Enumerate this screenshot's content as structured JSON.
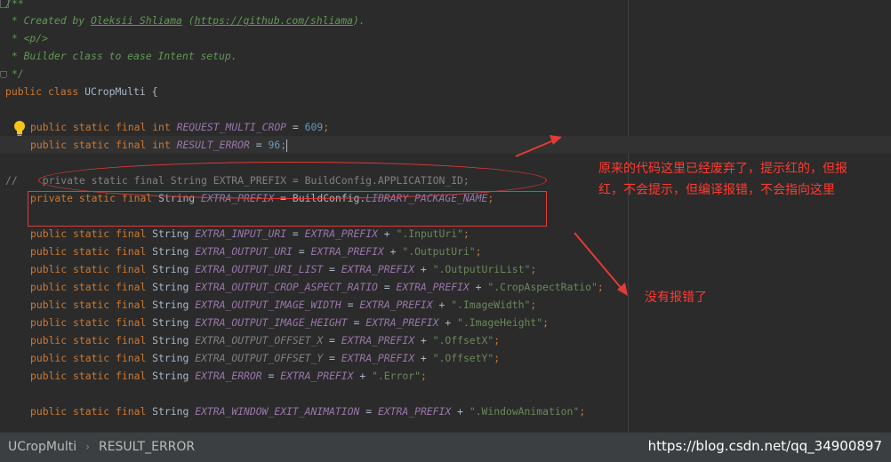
{
  "editor": {
    "lines": {
      "l1": "/**",
      "l2_pre": " * Created by ",
      "l2_author": "Oleksii Shliama",
      "l2_mid": " (",
      "l2_url": "https://github.com/shliama",
      "l2_post": ").",
      "l3": " * <p/>",
      "l4": " * Builder class to ease Intent setup.",
      "l5": " */",
      "l6_kw": "public class",
      "l6_name": " UCropMulti {",
      "l8_kw": "public static final int",
      "l8_const": "REQUEST_MULTI_CROP",
      "l8_eq": " = ",
      "l8_num": "609",
      "l8_end": ";",
      "l9_kw": "public static final int",
      "l9_const": "RESULT_ERROR",
      "l9_eq": " = ",
      "l9_num": "96",
      "l9_end": ";",
      "l11_prefix": "//",
      "l11_code": "private static final String EXTRA_PREFIX = BuildConfig.APPLICATION_ID;",
      "l12_kw": "private static final",
      "l12_type": " String ",
      "l12_const": "EXTRA_PREFIX",
      "l12_mid": " = BuildConfig.",
      "l12_const2": "LIBRARY_PACKAGE_NAME",
      "l12_end": ";"
    },
    "extras": [
      {
        "kw": "public static final",
        "type": " String ",
        "name": "EXTRA_INPUT_URI",
        "plus": " = ",
        "prefix": "EXTRA_PREFIX",
        "op": " + ",
        "value": "\".InputUri\"",
        "end": ";",
        "dim": false
      },
      {
        "kw": "public static final",
        "type": " String ",
        "name": "EXTRA_OUTPUT_URI",
        "plus": " = ",
        "prefix": "EXTRA_PREFIX",
        "op": " + ",
        "value": "\".OutputUri\"",
        "end": ";",
        "dim": false
      },
      {
        "kw": "public static final",
        "type": " String ",
        "name": "EXTRA_OUTPUT_URI_LIST",
        "plus": " = ",
        "prefix": "EXTRA_PREFIX",
        "op": " + ",
        "value": "\".OutputUriList\"",
        "end": ";",
        "dim": false
      },
      {
        "kw": "public static final",
        "type": " String ",
        "name": "EXTRA_OUTPUT_CROP_ASPECT_RATIO",
        "plus": " = ",
        "prefix": "EXTRA_PREFIX",
        "op": " + ",
        "value": "\".CropAspectRatio\"",
        "end": ";",
        "dim": false
      },
      {
        "kw": "public static final",
        "type": " String ",
        "name": "EXTRA_OUTPUT_IMAGE_WIDTH",
        "plus": " = ",
        "prefix": "EXTRA_PREFIX",
        "op": " + ",
        "value": "\".ImageWidth\"",
        "end": ";",
        "dim": false
      },
      {
        "kw": "public static final",
        "type": " String ",
        "name": "EXTRA_OUTPUT_IMAGE_HEIGHT",
        "plus": " = ",
        "prefix": "EXTRA_PREFIX",
        "op": " + ",
        "value": "\".ImageHeight\"",
        "end": ";",
        "dim": false
      },
      {
        "kw": "public static final",
        "type": " String ",
        "name": "EXTRA_OUTPUT_OFFSET_X",
        "plus": " = ",
        "prefix": "EXTRA_PREFIX",
        "op": " + ",
        "value": "\".OffsetX\"",
        "end": ";",
        "dim": true
      },
      {
        "kw": "public static final",
        "type": " String ",
        "name": "EXTRA_OUTPUT_OFFSET_Y",
        "plus": " = ",
        "prefix": "EXTRA_PREFIX",
        "op": " + ",
        "value": "\".OffsetY\"",
        "end": ";",
        "dim": true
      },
      {
        "kw": "public static final",
        "type": " String ",
        "name": "EXTRA_ERROR",
        "plus": " = ",
        "prefix": "EXTRA_PREFIX",
        "op": " + ",
        "value": "\".Error\"",
        "end": ";",
        "dim": false
      },
      {
        "kw": "public static final",
        "type": " String ",
        "name": "EXTRA_WINDOW_EXIT_ANIMATION",
        "plus": " = ",
        "prefix": "EXTRA_PREFIX",
        "op": " + ",
        "value": "\".WindowAnimation\"",
        "end": ";",
        "dim": false
      }
    ]
  },
  "annotations": {
    "note_1_line_1": "原来的代码这里已经废弃了，提示红的，但报",
    "note_1_line_2": "红，不会提示，但编译报错，不会指向这里",
    "note_2": "没有报错了"
  },
  "status_bar": {
    "crumb_class": "UCropMulti",
    "crumb_separator": "›",
    "crumb_field": "RESULT_ERROR"
  },
  "watermark": "https://blog.csdn.net/qq_34900897",
  "colors": {
    "background": "#2b2b2b",
    "keyword": "#cc7832",
    "constant": "#9876aa",
    "string": "#6a8759",
    "number": "#6897bb",
    "comment": "#629755",
    "annotation_red": "#ff3b30"
  },
  "icons": [
    "fold-marker-icon",
    "lightbulb-icon",
    "breadcrumb-chevron-icon"
  ]
}
